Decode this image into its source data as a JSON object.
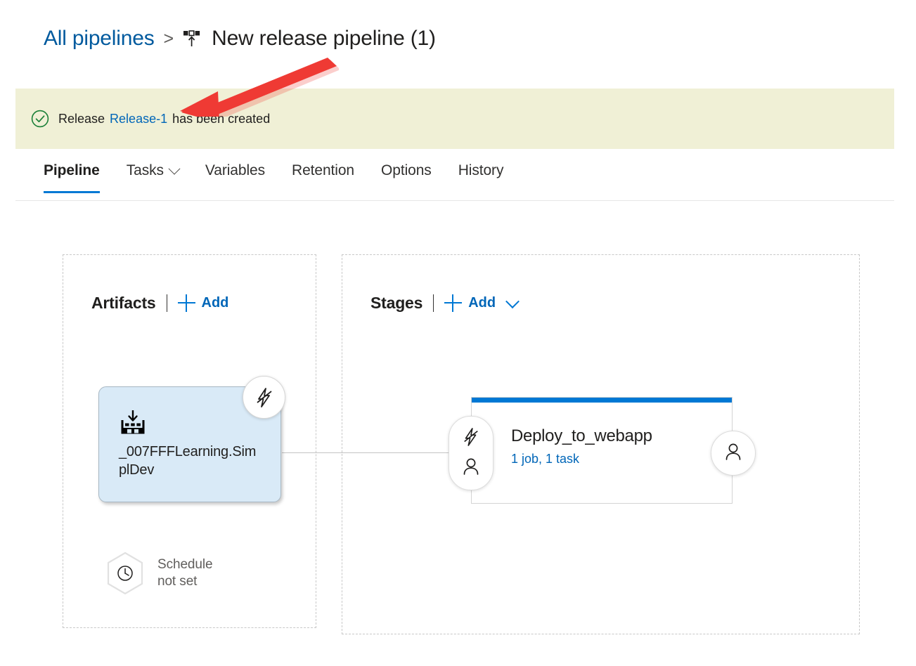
{
  "breadcrumb": {
    "parent_label": "All pipelines",
    "separator": ">",
    "pipeline_icon": "release-pipeline-icon",
    "current_label": "New release pipeline (1)"
  },
  "notification": {
    "icon": "success-check-circle-icon",
    "prefix": "Release",
    "link_label": "Release-1",
    "suffix": "has been created",
    "background_color": "#f0f0d6",
    "icon_color": "#107c10"
  },
  "tabs": [
    {
      "label": "Pipeline",
      "active": true,
      "has_chevron": false
    },
    {
      "label": "Tasks",
      "active": false,
      "has_chevron": true
    },
    {
      "label": "Variables",
      "active": false,
      "has_chevron": false
    },
    {
      "label": "Retention",
      "active": false,
      "has_chevron": false
    },
    {
      "label": "Options",
      "active": false,
      "has_chevron": false
    },
    {
      "label": "History",
      "active": false,
      "has_chevron": false
    }
  ],
  "artifacts_panel": {
    "title": "Artifacts",
    "add_label": "Add",
    "add_icon": "plus-icon",
    "artifact": {
      "icon": "build-artifact-icon",
      "name": "_007FFFLearning.SimplDev",
      "trigger_badge_icon": "continuous-deployment-trigger-disabled-icon"
    },
    "schedule": {
      "icon": "clock-hexagon-icon",
      "line1": "Schedule",
      "line2": "not set"
    }
  },
  "stages_panel": {
    "title": "Stages",
    "add_label": "Add",
    "add_icon": "plus-icon",
    "add_chevron_icon": "chevron-down-icon",
    "stage": {
      "name": "Deploy_to_webapp",
      "summary": "1 job, 1 task",
      "accent_color": "#0078d4",
      "pre_deployment_icons": [
        "trigger-disabled-icon",
        "person-approval-icon"
      ],
      "post_deployment_icon": "person-approval-icon"
    }
  },
  "annotation": {
    "type": "red-arrow",
    "color": "#ef3a34",
    "points_to": "Release-1"
  },
  "theme": {
    "link_color": "#0066b8",
    "accent_color": "#0078d4",
    "text_color": "#201f1e",
    "muted_text_color": "#605e5c",
    "artifact_fill": "#d9eaf7"
  }
}
